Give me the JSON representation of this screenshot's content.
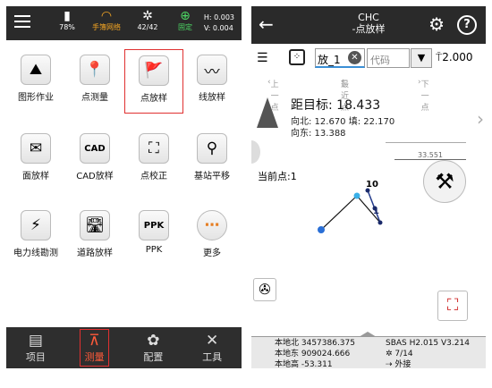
{
  "left_screen": {
    "status": {
      "battery": "78%",
      "network": "手簿网络",
      "satellites": "42/42",
      "fix": "固定",
      "h": "H: 0.003",
      "v": "V: 0.004"
    },
    "apps": [
      {
        "label": "图形作业",
        "icon": "graph-work-icon",
        "glyph": "⛰"
      },
      {
        "label": "点测量",
        "icon": "point-survey-icon",
        "glyph": "📍"
      },
      {
        "label": "点放样",
        "icon": "point-stakeout-icon",
        "glyph": "🚩"
      },
      {
        "label": "线放样",
        "icon": "line-stakeout-icon",
        "glyph": "〰"
      },
      {
        "label": "面放样",
        "icon": "area-stakeout-icon",
        "glyph": "✉"
      },
      {
        "label": "CAD放样",
        "icon": "cad-stakeout-icon",
        "glyph": "CAD"
      },
      {
        "label": "点校正",
        "icon": "point-calibration-icon",
        "glyph": "⛶"
      },
      {
        "label": "基站平移",
        "icon": "base-shift-icon",
        "glyph": "⚲"
      },
      {
        "label": "电力线勘测",
        "icon": "power-line-icon",
        "glyph": "⚡"
      },
      {
        "label": "道路放样",
        "icon": "road-stakeout-icon",
        "glyph": "🛣"
      },
      {
        "label": "PPK",
        "icon": "ppk-icon",
        "glyph": "PPK"
      },
      {
        "label": "更多",
        "icon": "more-icon",
        "glyph": "⋯"
      }
    ],
    "nav": [
      {
        "label": "项目",
        "glyph": "▤"
      },
      {
        "label": "测量",
        "glyph": "⊼"
      },
      {
        "label": "配置",
        "glyph": "✿"
      },
      {
        "label": "工具",
        "glyph": "✕"
      }
    ]
  },
  "right_screen": {
    "title1": "CHC",
    "title2": "-点放样",
    "point_name": "放_1",
    "code_placeholder": "代码",
    "antenna_height": "2.000",
    "prev_label": "上一点",
    "nearest_label": "最近点",
    "next_label": "下一点",
    "distance": "距目标: 18.433",
    "north_fill": "向北: 12.670 填: 22.170",
    "east": "向东: 13.388",
    "scale": "33.551",
    "current_point": "当前点:1",
    "map_label_1": "10",
    "map_label_2": "1",
    "north": "本地北 3457386.375",
    "east_coord": "本地东 909024.666",
    "height": "本地高 -53.311",
    "sbas": "SBAS H2.015 V3.214",
    "sat_count": "7/14",
    "mode": "外接"
  }
}
